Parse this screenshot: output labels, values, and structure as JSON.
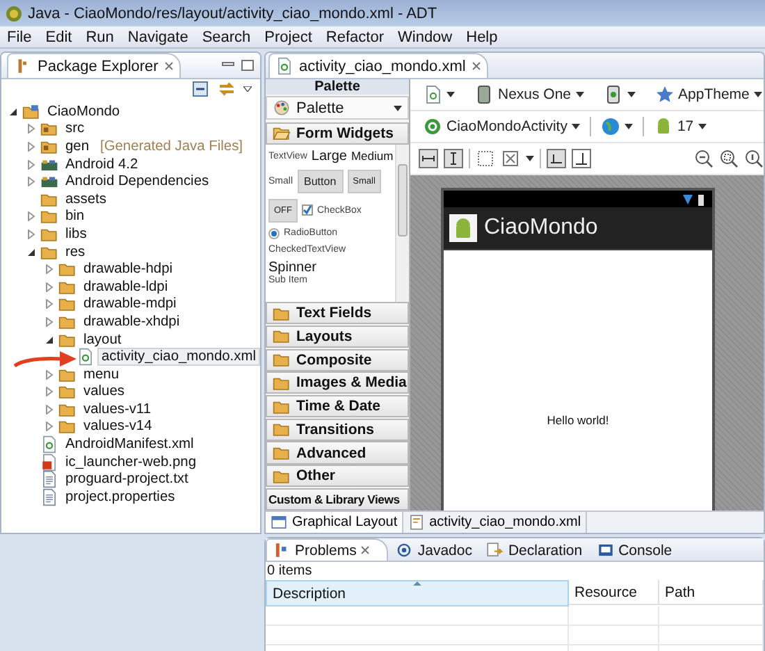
{
  "window": {
    "title": "Java - CiaoMondo/res/layout/activity_ciao_mondo.xml - ADT"
  },
  "menu": [
    "File",
    "Edit",
    "Run",
    "Navigate",
    "Search",
    "Project",
    "Refactor",
    "Window",
    "Help"
  ],
  "package_explorer": {
    "title": "Package Explorer",
    "tree": [
      {
        "label": "CiaoMondo",
        "kind": "project",
        "expanded": true,
        "selected": false,
        "children": [
          {
            "label": "src",
            "kind": "source-folder",
            "expanded": false,
            "selected": false
          },
          {
            "label": "gen",
            "decoration": "[Generated Java Files]",
            "kind": "source-folder",
            "expanded": false,
            "selected": false
          },
          {
            "label": "Android 4.2",
            "kind": "library",
            "expanded": false,
            "selected": false
          },
          {
            "label": "Android Dependencies",
            "kind": "library",
            "expanded": false,
            "selected": false
          },
          {
            "label": "assets",
            "kind": "folder",
            "selected": false
          },
          {
            "label": "bin",
            "kind": "folder",
            "expanded": false,
            "selected": false
          },
          {
            "label": "libs",
            "kind": "folder",
            "expanded": false,
            "selected": false
          },
          {
            "label": "res",
            "kind": "folder",
            "expanded": true,
            "selected": false,
            "children": [
              {
                "label": "drawable-hdpi",
                "kind": "folder",
                "expanded": false,
                "selected": false
              },
              {
                "label": "drawable-ldpi",
                "kind": "folder",
                "expanded": false,
                "selected": false
              },
              {
                "label": "drawable-mdpi",
                "kind": "folder",
                "expanded": false,
                "selected": false
              },
              {
                "label": "drawable-xhdpi",
                "kind": "folder",
                "expanded": false,
                "selected": false
              },
              {
                "label": "layout",
                "kind": "folder",
                "expanded": true,
                "selected": false,
                "children": [
                  {
                    "label": "activity_ciao_mondo.xml",
                    "kind": "xml-file",
                    "selected": true
                  }
                ]
              },
              {
                "label": "menu",
                "kind": "folder",
                "expanded": false,
                "selected": false
              },
              {
                "label": "values",
                "kind": "folder",
                "expanded": false,
                "selected": false
              },
              {
                "label": "values-v11",
                "kind": "folder",
                "expanded": false,
                "selected": false
              },
              {
                "label": "values-v14",
                "kind": "folder",
                "expanded": false,
                "selected": false
              }
            ]
          },
          {
            "label": "AndroidManifest.xml",
            "kind": "xml-file",
            "selected": false
          },
          {
            "label": "ic_launcher-web.png",
            "kind": "image-file",
            "selected": false
          },
          {
            "label": "proguard-project.txt",
            "kind": "text-file",
            "selected": false
          },
          {
            "label": "project.properties",
            "kind": "text-file",
            "selected": false
          }
        ]
      }
    ]
  },
  "editor": {
    "tab": "activity_ciao_mondo.xml",
    "palette": {
      "title": "Palette",
      "dropdown": "Palette",
      "sections": [
        {
          "label": "Form Widgets",
          "kind": "folder",
          "expanded": true
        },
        {
          "label": "Text Fields",
          "kind": "folder",
          "expanded": false
        },
        {
          "label": "Layouts",
          "kind": "folder",
          "expanded": false
        },
        {
          "label": "Composite",
          "kind": "folder",
          "expanded": false
        },
        {
          "label": "Images & Media",
          "kind": "folder",
          "expanded": false
        },
        {
          "label": "Time & Date",
          "kind": "folder",
          "expanded": false
        },
        {
          "label": "Transitions",
          "kind": "folder",
          "expanded": false
        },
        {
          "label": "Advanced",
          "kind": "folder",
          "expanded": false
        },
        {
          "label": "Other",
          "kind": "folder",
          "expanded": false
        },
        {
          "label": "Custom & Library Views",
          "kind": "plain",
          "expanded": false
        }
      ],
      "widgets": {
        "textview": "TextView",
        "large": "Large",
        "medium": "Medium",
        "small_label": "Small",
        "button": "Button",
        "small_button": "Small",
        "toggle": "OFF",
        "checkbox": {
          "label": "CheckBox",
          "checked": true
        },
        "radio": {
          "label": "RadioButton",
          "checked": true
        },
        "checked_text_view": "CheckedTextView",
        "spinner": "Spinner",
        "spinner_sub": "Sub Item"
      }
    },
    "toolbar": {
      "device": "Nexus One",
      "theme": "AppTheme",
      "activity": "CiaoMondoActivity",
      "api_level": "17"
    },
    "preview": {
      "app_title": "CiaoMondo",
      "content": "Hello world!"
    },
    "view_tabs": [
      {
        "label": "Graphical Layout",
        "selected": true
      },
      {
        "label": "activity_ciao_mondo.xml",
        "selected": false
      }
    ]
  },
  "problems": {
    "tabs": [
      {
        "label": "Problems",
        "selected": true
      },
      {
        "label": "Javadoc",
        "selected": false
      },
      {
        "label": "Declaration",
        "selected": false
      },
      {
        "label": "Console",
        "selected": false
      }
    ],
    "count": "0 items",
    "columns": [
      {
        "label": "Description",
        "sorted": true
      },
      {
        "label": "Resource",
        "sorted": false
      },
      {
        "label": "Path",
        "sorted": false
      }
    ]
  }
}
